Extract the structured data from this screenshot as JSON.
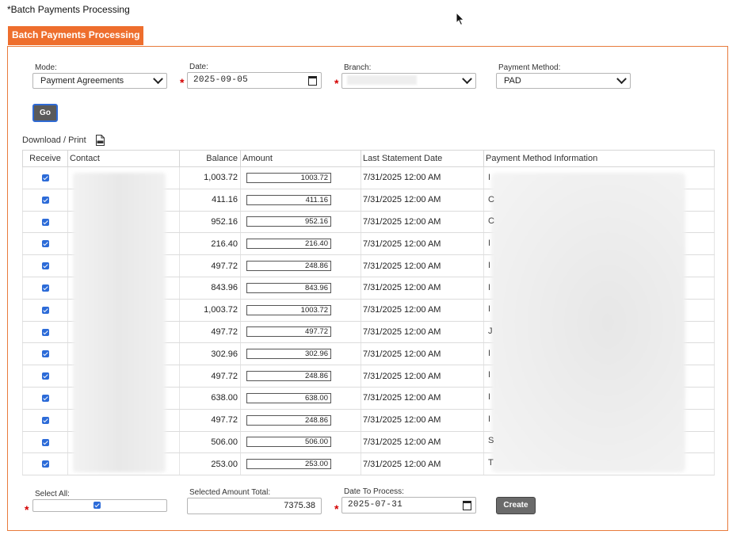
{
  "page_title": "*Batch Payments Processing",
  "tab_label": "Batch Payments Processing",
  "filters": {
    "mode_label": "Mode:",
    "mode_value": "Payment Agreements",
    "date_label": "Date:",
    "date_value": "2025-09-05",
    "branch_label": "Branch:",
    "payment_method_label": "Payment Method:",
    "payment_method_value": "PAD",
    "go_label": "Go"
  },
  "download_label": "Download / Print",
  "table": {
    "headers": [
      "Receive",
      "Contact",
      "Balance",
      "Amount",
      "Last Statement Date",
      "Payment Method Information"
    ],
    "rows": [
      {
        "balance": "1,003.72",
        "amount": "1003.72",
        "last_statement": "7/31/2025 12:00 AM",
        "pmi_initial": "I"
      },
      {
        "balance": "411.16",
        "amount": "411.16",
        "last_statement": "7/31/2025 12:00 AM",
        "pmi_initial": "C"
      },
      {
        "balance": "952.16",
        "amount": "952.16",
        "last_statement": "7/31/2025 12:00 AM",
        "pmi_initial": "C"
      },
      {
        "balance": "216.40",
        "amount": "216.40",
        "last_statement": "7/31/2025 12:00 AM",
        "pmi_initial": "I"
      },
      {
        "balance": "497.72",
        "amount": "248.86",
        "last_statement": "7/31/2025 12:00 AM",
        "pmi_initial": "I"
      },
      {
        "balance": "843.96",
        "amount": "843.96",
        "last_statement": "7/31/2025 12:00 AM",
        "pmi_initial": "I"
      },
      {
        "balance": "1,003.72",
        "amount": "1003.72",
        "last_statement": "7/31/2025 12:00 AM",
        "pmi_initial": "I"
      },
      {
        "balance": "497.72",
        "amount": "497.72",
        "last_statement": "7/31/2025 12:00 AM",
        "pmi_initial": "J"
      },
      {
        "balance": "302.96",
        "amount": "302.96",
        "last_statement": "7/31/2025 12:00 AM",
        "pmi_initial": "I"
      },
      {
        "balance": "497.72",
        "amount": "248.86",
        "last_statement": "7/31/2025 12:00 AM",
        "pmi_initial": "I"
      },
      {
        "balance": "638.00",
        "amount": "638.00",
        "last_statement": "7/31/2025 12:00 AM",
        "pmi_initial": "I"
      },
      {
        "balance": "497.72",
        "amount": "248.86",
        "last_statement": "7/31/2025 12:00 AM",
        "pmi_initial": "I"
      },
      {
        "balance": "506.00",
        "amount": "506.00",
        "last_statement": "7/31/2025 12:00 AM",
        "pmi_initial": "S"
      },
      {
        "balance": "253.00",
        "amount": "253.00",
        "last_statement": "7/31/2025 12:00 AM",
        "pmi_initial": "T"
      }
    ]
  },
  "footer": {
    "select_all_label": "Select All:",
    "selected_total_label": "Selected Amount Total:",
    "selected_total_value": "7375.38",
    "date_to_process_label": "Date To Process:",
    "date_to_process_value": "2025-07-31",
    "create_label": "Create"
  },
  "colors": {
    "accent": "#ee6e2d",
    "checkbox": "#2c6bd8",
    "required": "#d40000"
  }
}
